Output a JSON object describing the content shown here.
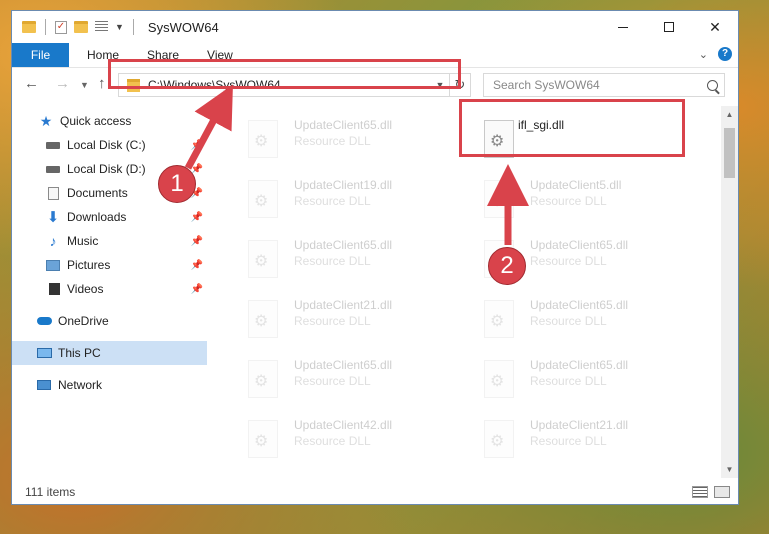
{
  "window": {
    "title": "SysWOW64",
    "address_path": "C:\\Windows\\SysWOW64",
    "search_placeholder": "Search SysWOW64",
    "status_count": "111 items"
  },
  "ribbon": {
    "tabs": [
      "File",
      "Home",
      "Share",
      "View"
    ]
  },
  "sidebar": {
    "items": [
      {
        "label": "Quick access",
        "icon": "star-icon",
        "pinned": false
      },
      {
        "label": "Local Disk (C:)",
        "icon": "drive-icon",
        "pinned": true
      },
      {
        "label": "Local Disk (D:)",
        "icon": "drive-icon",
        "pinned": true
      },
      {
        "label": "Documents",
        "icon": "documents-icon",
        "pinned": true
      },
      {
        "label": "Downloads",
        "icon": "download-icon",
        "pinned": true
      },
      {
        "label": "Music",
        "icon": "music-icon",
        "pinned": true
      },
      {
        "label": "Pictures",
        "icon": "pictures-icon",
        "pinned": true
      },
      {
        "label": "Videos",
        "icon": "videos-icon",
        "pinned": true
      },
      {
        "label": "OneDrive",
        "icon": "cloud-icon",
        "pinned": false
      },
      {
        "label": "This PC",
        "icon": "computer-icon",
        "pinned": false,
        "selected": true
      },
      {
        "label": "Network",
        "icon": "network-icon",
        "pinned": false
      }
    ]
  },
  "files": {
    "highlighted": {
      "name": "ifl_sgi.dll",
      "type": ""
    },
    "left_column": [
      {
        "name": "UpdateClient65.dll",
        "type": "Resource DLL"
      },
      {
        "name": "UpdateClient19.dll",
        "type": "Resource DLL"
      },
      {
        "name": "UpdateClient65.dll",
        "type": "Resource DLL"
      },
      {
        "name": "UpdateClient21.dll",
        "type": "Resource DLL"
      },
      {
        "name": "UpdateClient65.dll",
        "type": "Resource DLL"
      },
      {
        "name": "UpdateClient42.dll",
        "type": "Resource DLL"
      }
    ],
    "right_column": [
      {
        "name": "UpdateClient5.dll",
        "type": "Resource DLL"
      },
      {
        "name": "UpdateClient65.dll",
        "type": "Resource DLL"
      },
      {
        "name": "UpdateClient65.dll",
        "type": "Resource DLL"
      },
      {
        "name": "UpdateClient65.dll",
        "type": "Resource DLL"
      },
      {
        "name": "UpdateClient21.dll",
        "type": "Resource DLL"
      }
    ]
  },
  "annotations": {
    "step1": "1",
    "step2": "2",
    "highlight_color": "#d9434b"
  },
  "colors": {
    "accent": "#1979ca",
    "selected_bg": "#cce0f5"
  }
}
